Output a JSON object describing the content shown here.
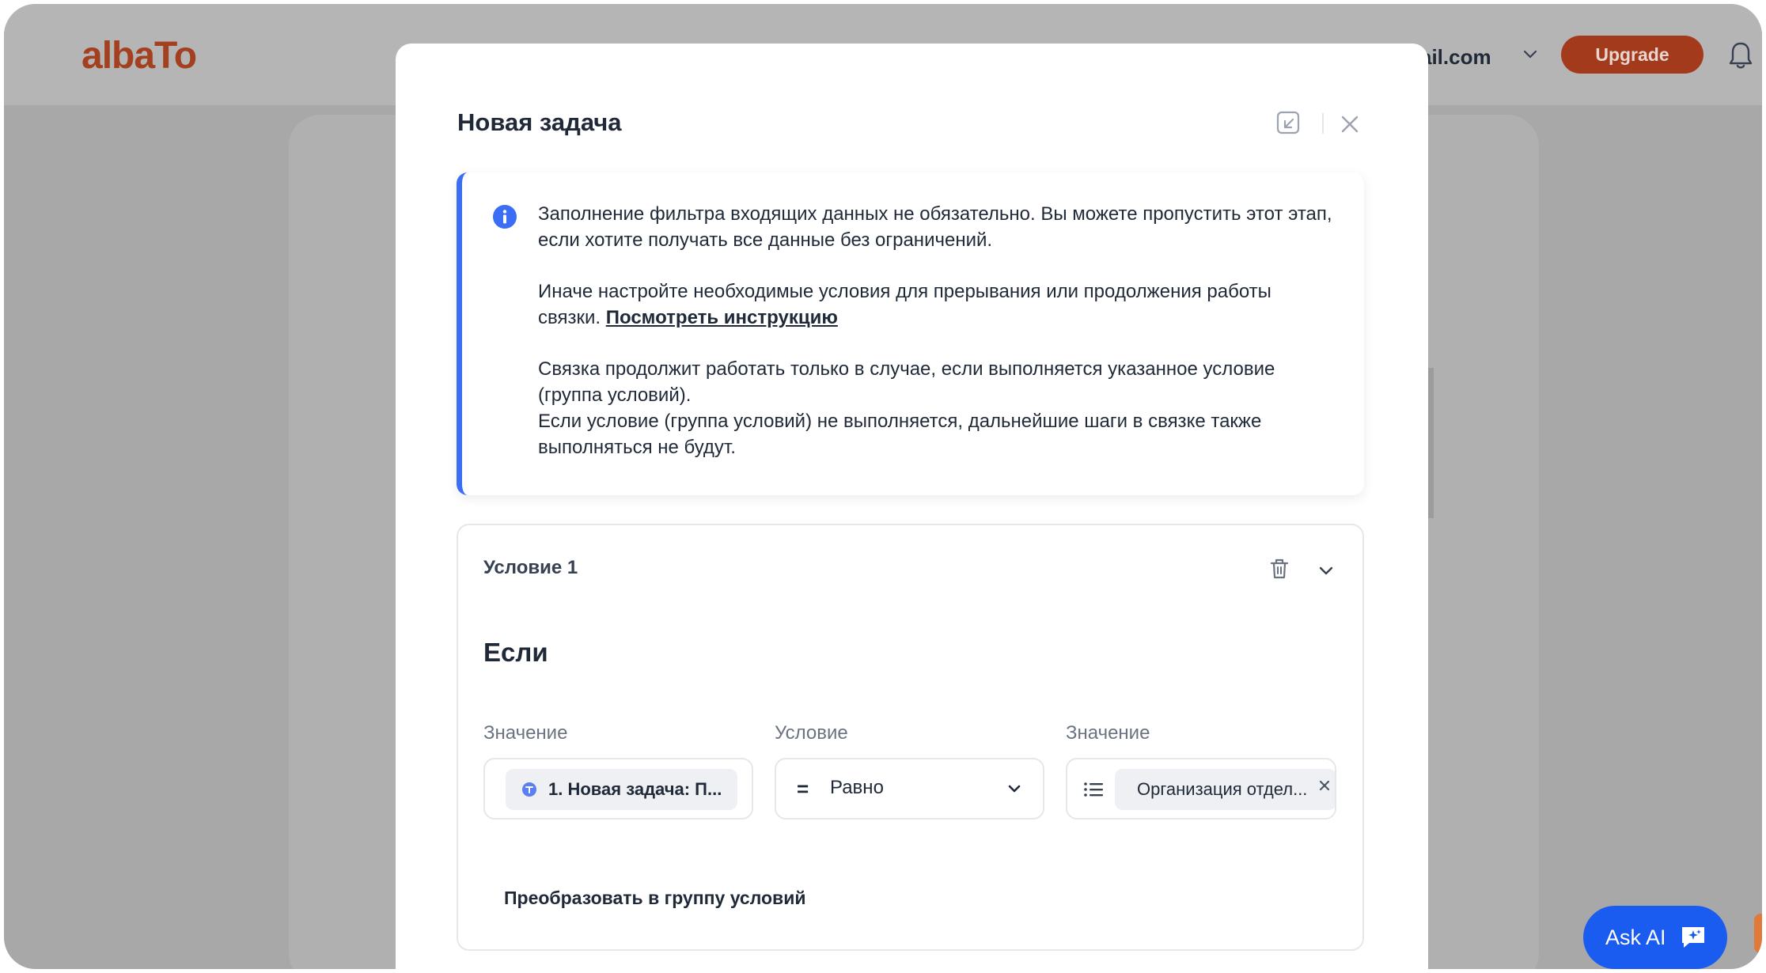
{
  "app": {
    "logo": "albaTo",
    "user_email_partial": "ail.com",
    "upgrade_label": "Upgrade",
    "brand_color": "#a33a1c"
  },
  "modal": {
    "title": "Новая задача",
    "info": {
      "p1": "Заполнение фильтра входящих данных не обязательно. Вы можете пропустить этот этап, если хотите получать все данные без ограничений.",
      "p2_prefix": "Иначе настройте необходимые условия для прерывания или продолжения работы связки. ",
      "p2_link": "Посмотреть инструкцию",
      "p3": "Связка продолжит работать только в случае, если выполняется указанное условие (группа условий).",
      "p4": "Если условие (группа условий) не выполняется, дальнейшие шаги в связке также выполняться не будут.",
      "accent_color": "#3b6ef5"
    },
    "condition": {
      "title": "Условие 1",
      "if_label": "Если",
      "columns": {
        "value_left_label": "Значение",
        "operator_label": "Условие",
        "value_right_label": "Значение"
      },
      "left_value_chip": "1. Новая задача: П...",
      "operator_symbol": "=",
      "operator_value": "Равно",
      "right_value_chip": "Организация отдел...",
      "convert_label": "Преобразовать в группу условий"
    }
  },
  "ask_ai": {
    "label": "Ask AI",
    "color": "#1a5cf0"
  }
}
